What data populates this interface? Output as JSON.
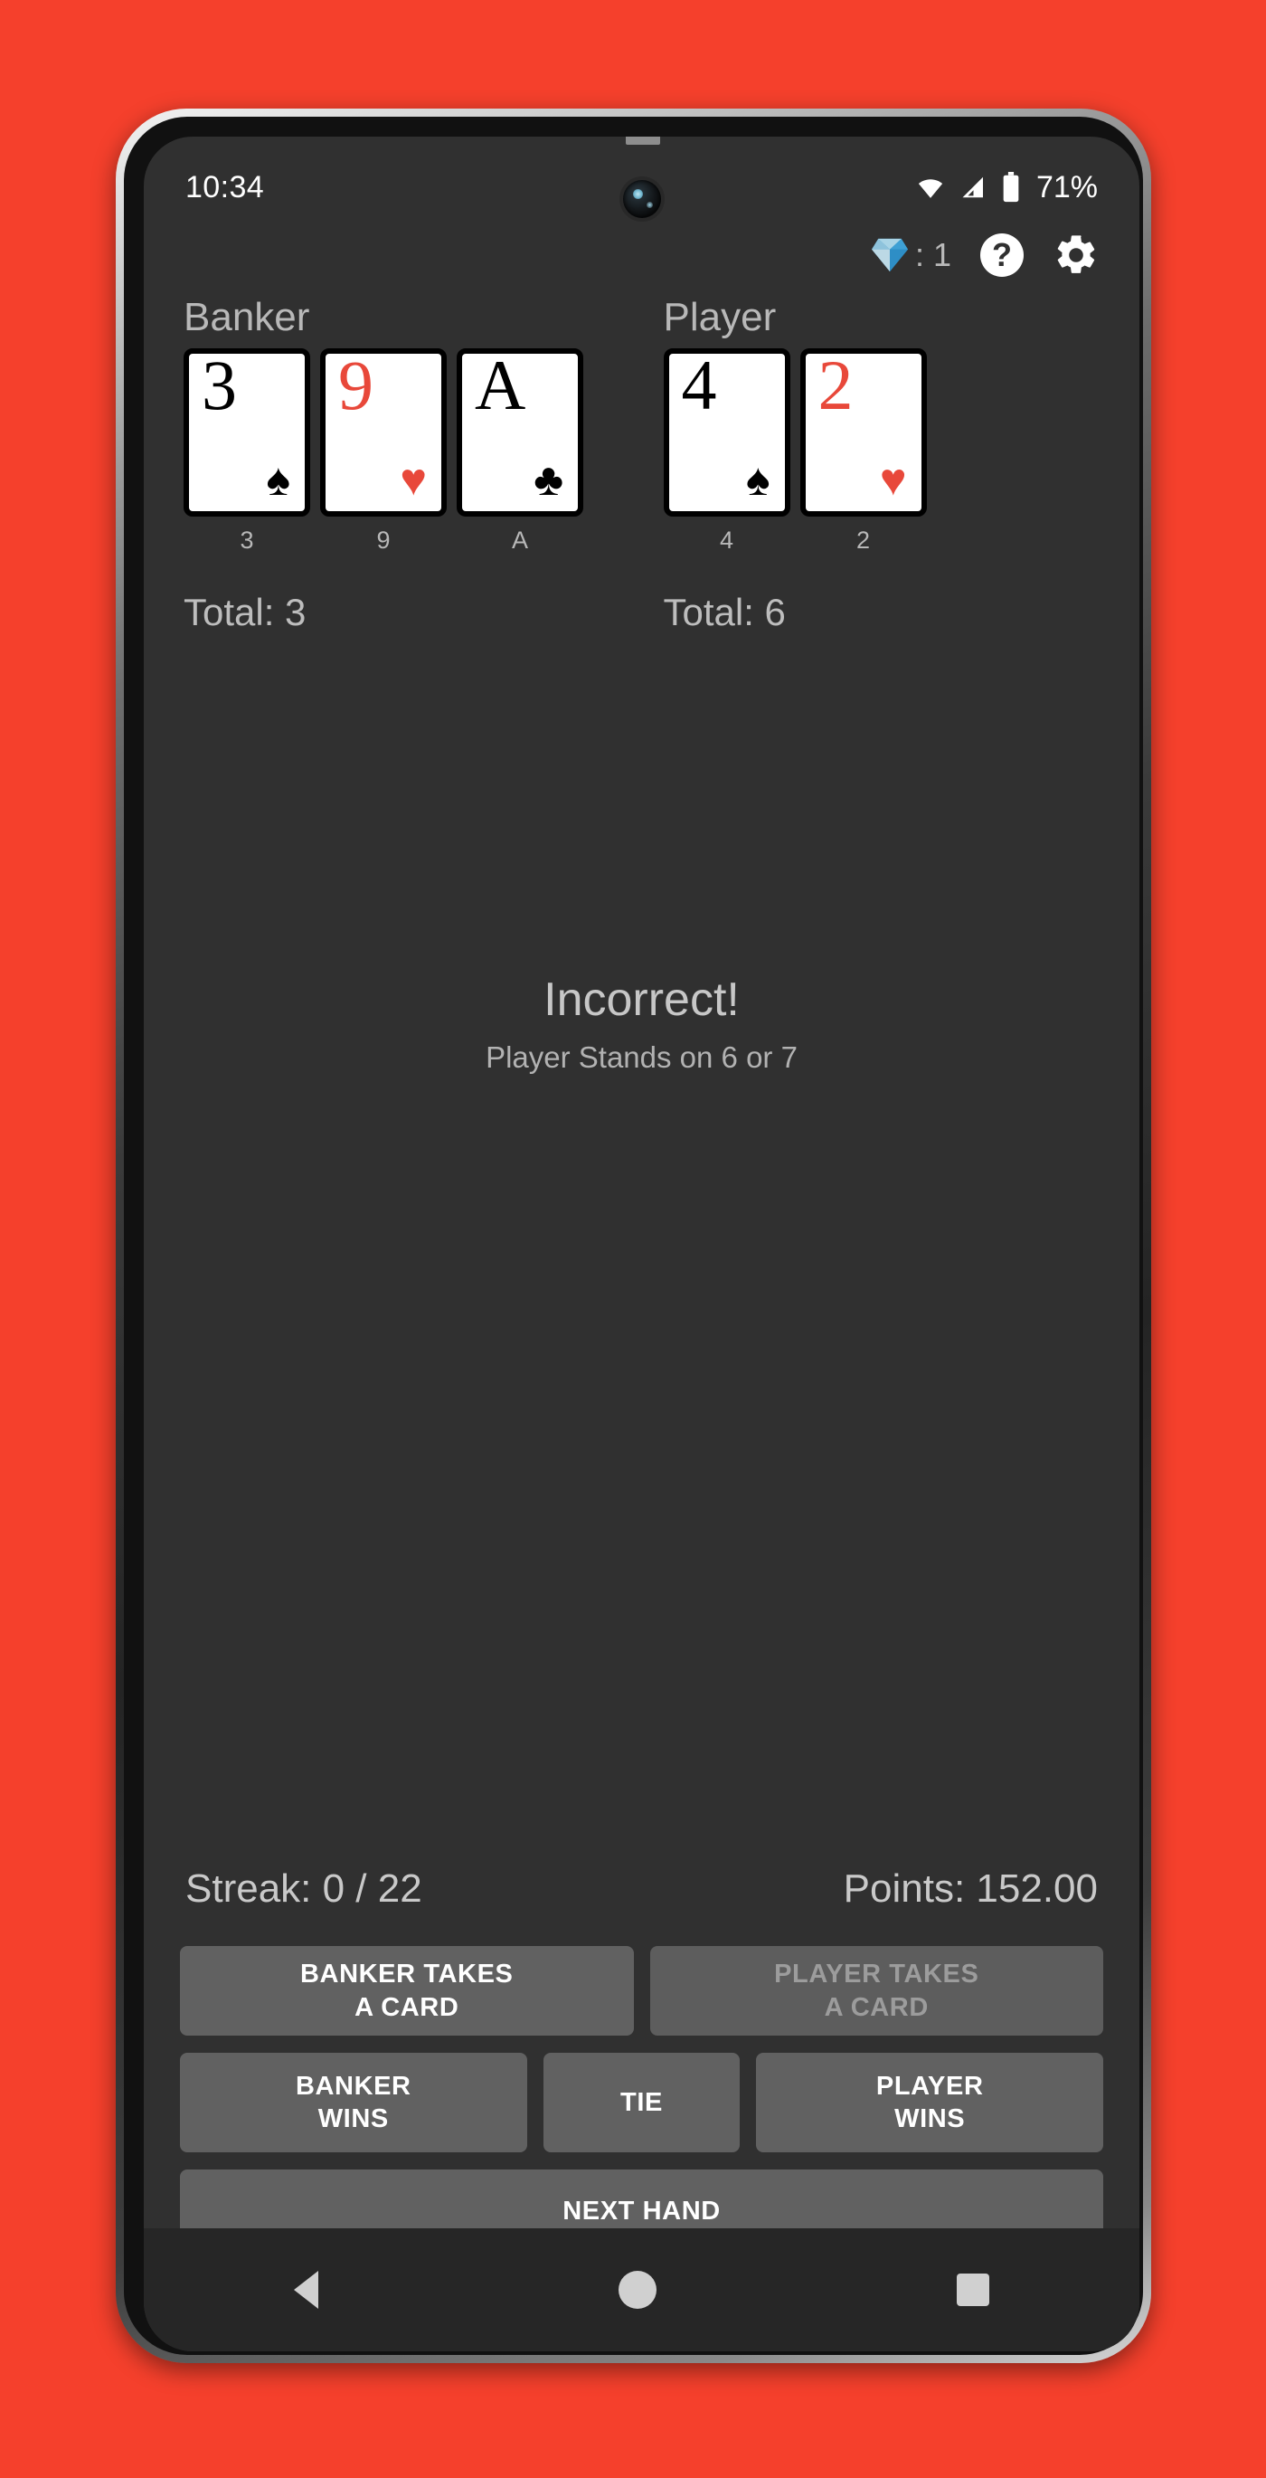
{
  "status_bar": {
    "time": "10:34",
    "battery_percent": "71%",
    "icons": [
      "wifi-icon",
      "cellular-signal-icon",
      "battery-icon"
    ]
  },
  "app_bar": {
    "gem_icon": "diamond-icon",
    "gem_count": ": 1",
    "help_label": "?",
    "settings_icon": "gear-icon"
  },
  "banker": {
    "title": "Banker",
    "cards": [
      {
        "rank": "3",
        "suit": "♠",
        "color": "black",
        "label": "3"
      },
      {
        "rank": "9",
        "suit": "♥",
        "color": "red",
        "label": "9"
      },
      {
        "rank": "A",
        "suit": "♣",
        "color": "black",
        "label": "A"
      }
    ],
    "total": "Total: 3"
  },
  "player": {
    "title": "Player",
    "cards": [
      {
        "rank": "4",
        "suit": "♠",
        "color": "black",
        "label": "4"
      },
      {
        "rank": "2",
        "suit": "♥",
        "color": "red",
        "label": "2"
      }
    ],
    "total": "Total: 6"
  },
  "feedback": {
    "title": "Incorrect!",
    "subtitle": "Player Stands on 6 or 7"
  },
  "score": {
    "streak": "Streak: 0 / 22",
    "points": "Points: 152.00"
  },
  "buttons": {
    "banker_takes": "BANKER TAKES\nA CARD",
    "banker_takes_line1": "BANKER TAKES",
    "banker_takes_line2": "A CARD",
    "player_takes_line1": "PLAYER TAKES",
    "player_takes_line2": "A CARD",
    "banker_wins_line1": "BANKER",
    "banker_wins_line2": "WINS",
    "tie": "TIE",
    "player_wins_line1": "PLAYER",
    "player_wins_line2": "WINS",
    "next_hand": "NEXT HAND"
  },
  "nav_bar": {
    "back": "back-icon",
    "home": "home-icon",
    "recents": "recents-icon"
  },
  "colors": {
    "background": "#f5402c",
    "screen": "#303030",
    "button": "#616161",
    "card_red": "#e8483a",
    "text_muted": "#b8b8b8"
  }
}
